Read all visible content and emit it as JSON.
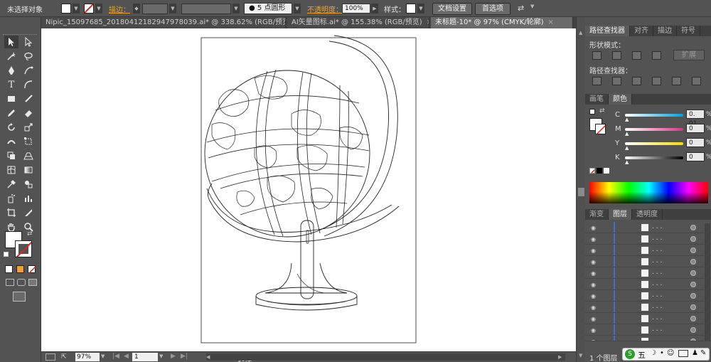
{
  "control_bar": {
    "selection_status": "未选择对象",
    "stroke_label": "描边：",
    "brush_size": "5",
    "brush_shape": "点圆形",
    "opacity_label": "不透明度：",
    "opacity_value": "100%",
    "style_label": "样式：",
    "doc_setup_button": "文档设置",
    "preferences_button": "首选项"
  },
  "tabs": [
    {
      "label": "Nipic_15097685_20180412182947978039.ai* @ 338.62% (RGB/预览)"
    },
    {
      "label": "AI矢量图标.ai* @ 155.38% (RGB/预览)"
    },
    {
      "label": "未标题-10* @ 97% (CMYK/轮廓)",
      "active": true
    }
  ],
  "tab_close_glyph": "×",
  "status_bar": {
    "zoom": "97%",
    "artboard": "1",
    "tool_status": "选择"
  },
  "pathfinder_panel": {
    "tabs": [
      "路径查找器",
      "对齐",
      "描边",
      "符号"
    ],
    "shape_modes_label": "形状模式：",
    "expand_button": "扩展",
    "pathfinders_label": "路径查找器："
  },
  "color_panel": {
    "tabs": [
      "画笔",
      "颜色"
    ],
    "channels": [
      {
        "label": "C",
        "value": "0. 01",
        "color": "#00a0e0"
      },
      {
        "label": "M",
        "value": "0",
        "color": "#e0308a"
      },
      {
        "label": "Y",
        "value": "0",
        "color": "#f0e000"
      },
      {
        "label": "K",
        "value": "0",
        "color": "#000000"
      }
    ],
    "percent": "%"
  },
  "layers_panel": {
    "tabs": [
      "渐变",
      "图层",
      "透明度"
    ],
    "rows": [
      {
        "name": ". . ."
      },
      {
        "name": ". . ."
      },
      {
        "name": ". . ."
      },
      {
        "name": ". . ."
      },
      {
        "name": ". . ."
      },
      {
        "name": ". . ."
      },
      {
        "name": ". . ."
      },
      {
        "name": ". . ."
      },
      {
        "name": ". . ."
      },
      {
        "name": ". . ."
      },
      {
        "name": ". . ."
      }
    ],
    "footer": "1 个图层"
  },
  "ime_bar": {
    "badge": "S",
    "label": "五"
  },
  "colors": {
    "accent_orange": "#f0a030",
    "ui_gray": "#535353",
    "layer_marker": "#3b6fd6"
  }
}
